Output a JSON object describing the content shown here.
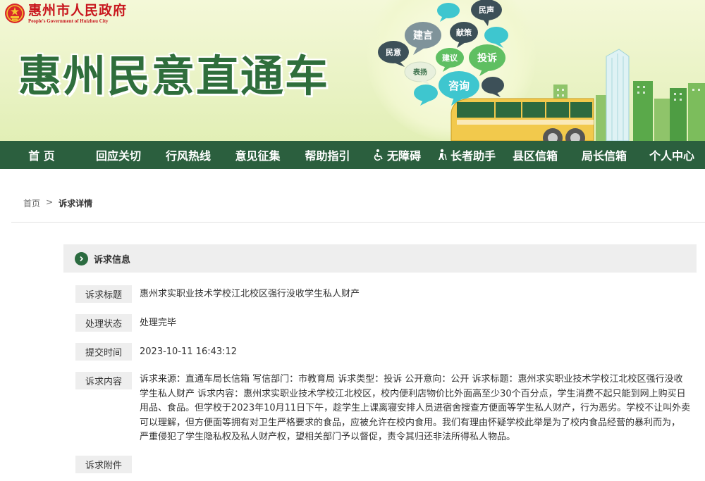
{
  "gov": {
    "name": "惠州市人民政府",
    "en": "People's Government of Huizhou City"
  },
  "site": {
    "title": "惠州民意直通车"
  },
  "bubbles": {
    "jianyan": "建言",
    "xiance": "献策",
    "minsheng": "民声",
    "minyi": "民意",
    "jianyi": "建议",
    "tousu": "投诉",
    "biaoyang": "表扬",
    "zixun": "咨询"
  },
  "nav": [
    {
      "label": "首 页",
      "icon": ""
    },
    {
      "label": "回应关切",
      "icon": ""
    },
    {
      "label": "行风热线",
      "icon": ""
    },
    {
      "label": "意见征集",
      "icon": ""
    },
    {
      "label": "帮助指引",
      "icon": ""
    },
    {
      "label": "无障碍",
      "icon": "wheelchair-icon"
    },
    {
      "label": "长者助手",
      "icon": "elder-icon"
    },
    {
      "label": "县区信箱",
      "icon": ""
    },
    {
      "label": "局长信箱",
      "icon": ""
    },
    {
      "label": "个人中心",
      "icon": ""
    }
  ],
  "breadcrumb": {
    "home": "首页",
    "sep": ">",
    "current": "诉求详情"
  },
  "section": {
    "title": "诉求信息",
    "icon": "chevron-right-circle-icon"
  },
  "fields": {
    "title": {
      "label": "诉求标题",
      "value": "惠州求实职业技术学校江北校区强行没收学生私人财产"
    },
    "status": {
      "label": "处理状态",
      "value": "处理完毕"
    },
    "time": {
      "label": "提交时间",
      "value": "2023-10-11 16:43:12"
    },
    "content": {
      "label": "诉求内容",
      "lines": [
        "诉求来源：直通车局长信箱 写信部门：市教育局 诉求类型：投诉 公开意向：公开 诉求标题：惠州求实职业技术学校江北校区强行没收",
        "学生私人财产 诉求内容：惠州求实职业技术学校江北校区，校内便利店物价比外面高至少30个百分点，学生消费不起只能到网上购买日",
        "用品、食品。但学校于2023年10月11日下午，趁学生上课离寝安排人员进宿舍搜查方便面等学生私人财产，行为恶劣。学校不让叫外卖",
        "可以理解，但方便面等拥有对卫生严格要求的食品，应被允许在校内食用。我们有理由怀疑学校此举是为了校内食品经营的暴利而为，",
        "严重侵犯了学生隐私权及私人财产权，望相关部门予以督促，责令其归还非法所得私人物品。"
      ]
    },
    "attachment": {
      "label": "诉求附件",
      "value": ""
    }
  },
  "colors": {
    "nav_bg": "#2b5f3e",
    "title_green": "#2f6e3c",
    "gov_red": "#c8161d",
    "label_bg": "#eeeeee",
    "bubble_teal": "#3ec6cf",
    "bubble_green": "#5fbf62",
    "bubble_gray": "#7f939a",
    "bubble_dark": "#3d5058"
  }
}
